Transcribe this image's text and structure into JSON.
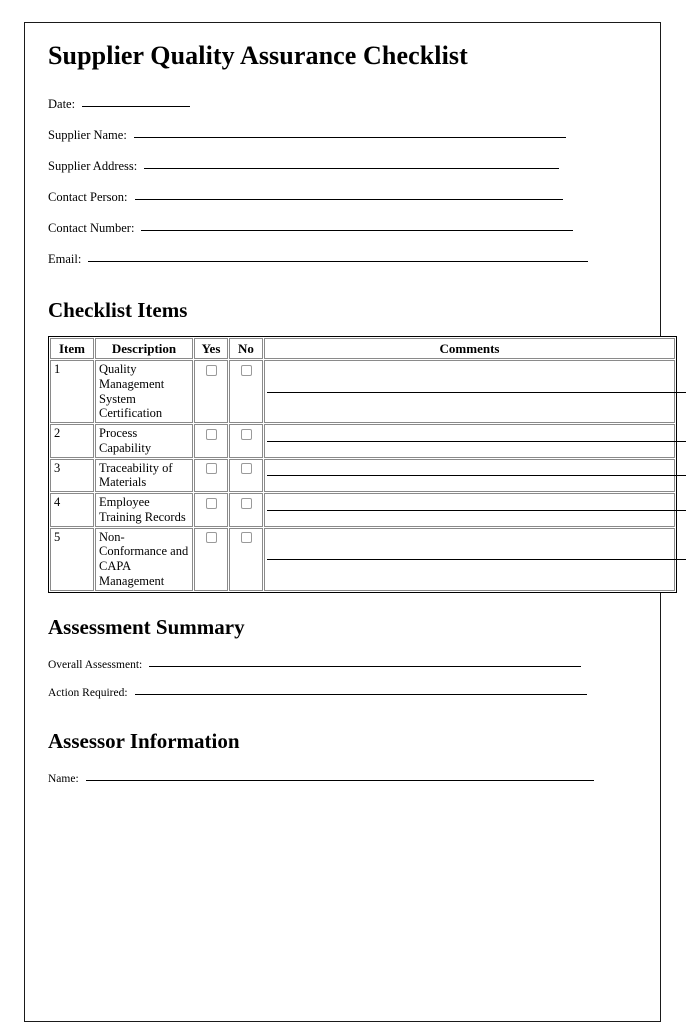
{
  "document": {
    "title": "Supplier Quality Assurance Checklist"
  },
  "header_fields": [
    {
      "label": "Date:",
      "rule_width": 108
    },
    {
      "label": "Supplier Name:",
      "rule_width": 432
    },
    {
      "label": "Supplier Address:",
      "rule_width": 415
    },
    {
      "label": "Contact Person:",
      "rule_width": 428
    },
    {
      "label": "Contact Number:",
      "rule_width": 432
    },
    {
      "label": "Email:",
      "rule_width": 500
    }
  ],
  "checklist": {
    "heading": "Checklist Items",
    "columns": [
      "Item",
      "Description",
      "Yes",
      "No",
      "Comments"
    ],
    "rows": [
      {
        "item": "1",
        "description": "Quality Management System Certification"
      },
      {
        "item": "2",
        "description": "Process Capability"
      },
      {
        "item": "3",
        "description": "Traceability of Materials"
      },
      {
        "item": "4",
        "description": "Employee Training Records"
      },
      {
        "item": "5",
        "description": "Non-Conformance and CAPA Management"
      }
    ]
  },
  "assessment_summary": {
    "heading": "Assessment Summary",
    "fields": [
      {
        "label": "Overall Assessment:",
        "rule_width": 432
      },
      {
        "label": "Action Required:",
        "rule_width": 452
      }
    ]
  },
  "assessor_information": {
    "heading": "Assessor Information",
    "fields": [
      {
        "label": "Name:",
        "rule_width": 508
      }
    ]
  }
}
